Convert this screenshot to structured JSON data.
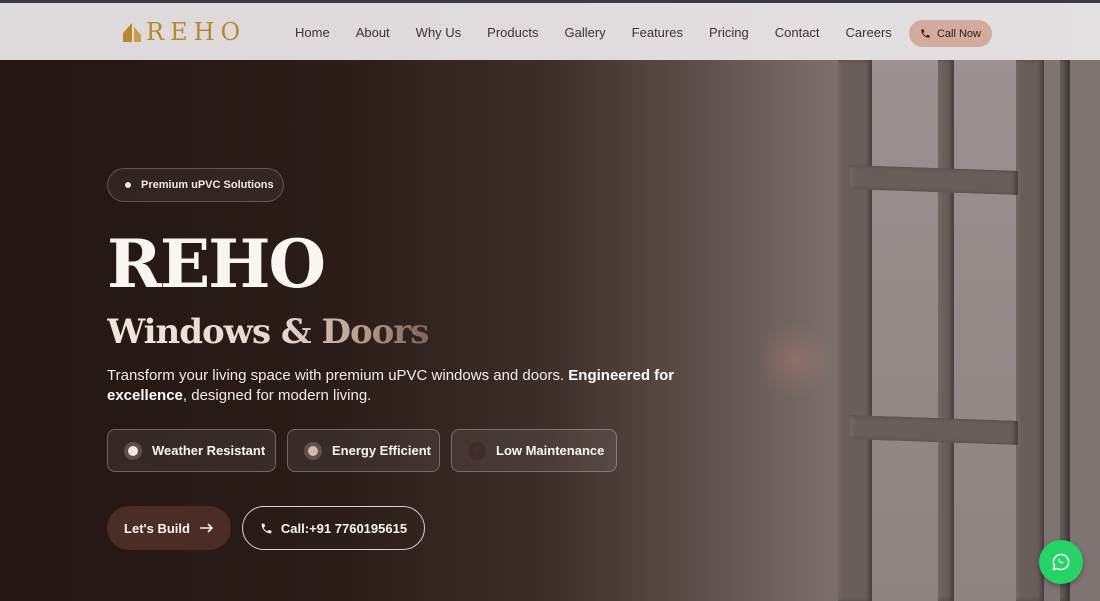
{
  "brand": {
    "logo_text": "REHO",
    "accent": "#b58a2e"
  },
  "nav": {
    "links": [
      "Home",
      "About",
      "Why Us",
      "Products",
      "Gallery",
      "Features",
      "Pricing",
      "Contact",
      "Careers"
    ],
    "cta_label": "Call Now"
  },
  "hero": {
    "badge": "Premium uPVC Solutions",
    "title": "REHO",
    "subtitle": "Windows & Doors",
    "description_plain": "Transform your living space with premium uPVC windows and doors. ",
    "description_bold_1": "Engineered for excellence",
    "description_tail": ", designed for modern living.",
    "features": [
      {
        "label": "Weather Resistant",
        "dot_color": "#f3e6de"
      },
      {
        "label": "Energy Efficient",
        "dot_color": "#d9b8a8"
      },
      {
        "label": "Low Maintenance",
        "dot_color": "#4a2d24"
      }
    ],
    "primary_button": "Let's Build",
    "secondary_button": "Call:+91 7760195615"
  },
  "colors": {
    "button_dark": "#4a2d24",
    "call_now_bg": "#d2ab9c",
    "whatsapp": "#25d366"
  },
  "icons": [
    "phone-icon",
    "arrow-right-icon",
    "whatsapp-icon",
    "logo-mark-icon"
  ]
}
